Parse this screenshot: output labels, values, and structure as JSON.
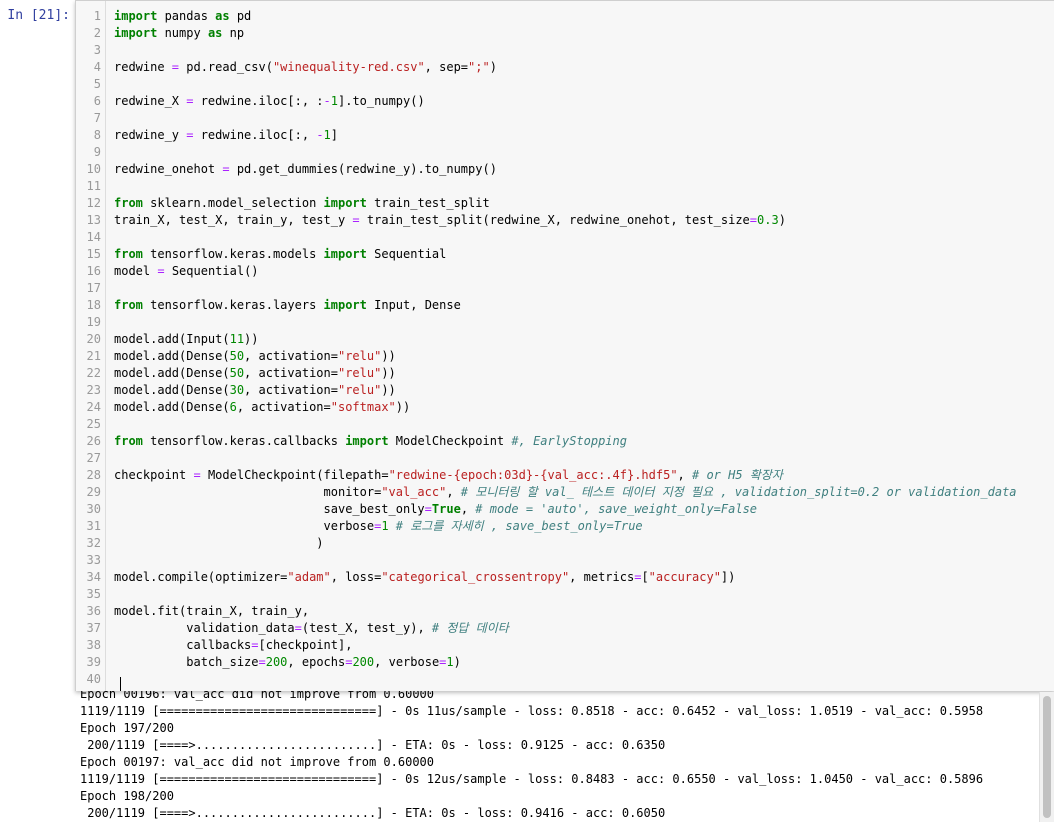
{
  "prompt": "In [21]:",
  "code_lines": [
    {
      "n": "1",
      "segs": [
        [
          "kw",
          "import"
        ],
        [
          "t",
          " pandas "
        ],
        [
          "kw",
          "as"
        ],
        [
          "t",
          " pd"
        ]
      ]
    },
    {
      "n": "2",
      "segs": [
        [
          "kw",
          "import"
        ],
        [
          "t",
          " numpy "
        ],
        [
          "kw",
          "as"
        ],
        [
          "t",
          " np"
        ]
      ]
    },
    {
      "n": "3",
      "segs": []
    },
    {
      "n": "4",
      "segs": [
        [
          "t",
          "redwine "
        ],
        [
          "op",
          "="
        ],
        [
          "t",
          " pd.read_csv("
        ],
        [
          "st",
          "\"winequality-red.csv\""
        ],
        [
          "t",
          ", sep="
        ],
        [
          "st",
          "\";\""
        ],
        [
          "t",
          ")"
        ]
      ]
    },
    {
      "n": "5",
      "segs": []
    },
    {
      "n": "6",
      "segs": [
        [
          "t",
          "redwine_X "
        ],
        [
          "op",
          "="
        ],
        [
          "t",
          " redwine.iloc[:, :"
        ],
        [
          "op",
          "-"
        ],
        [
          "nm",
          "1"
        ],
        [
          "t",
          "].to_numpy()"
        ]
      ]
    },
    {
      "n": "7",
      "segs": []
    },
    {
      "n": "8",
      "segs": [
        [
          "t",
          "redwine_y "
        ],
        [
          "op",
          "="
        ],
        [
          "t",
          " redwine.iloc[:, "
        ],
        [
          "op",
          "-"
        ],
        [
          "nm",
          "1"
        ],
        [
          "t",
          "]"
        ]
      ]
    },
    {
      "n": "9",
      "segs": []
    },
    {
      "n": "10",
      "segs": [
        [
          "t",
          "redwine_onehot "
        ],
        [
          "op",
          "="
        ],
        [
          "t",
          " pd.get_dummies(redwine_y).to_numpy()"
        ]
      ]
    },
    {
      "n": "11",
      "segs": []
    },
    {
      "n": "12",
      "segs": [
        [
          "kw",
          "from"
        ],
        [
          "t",
          " sklearn.model_selection "
        ],
        [
          "kw",
          "import"
        ],
        [
          "t",
          " train_test_split"
        ]
      ]
    },
    {
      "n": "13",
      "segs": [
        [
          "t",
          "train_X, test_X, train_y, test_y "
        ],
        [
          "op",
          "="
        ],
        [
          "t",
          " train_test_split(redwine_X, redwine_onehot, test_size"
        ],
        [
          "op",
          "="
        ],
        [
          "nm",
          "0.3"
        ],
        [
          "t",
          ")"
        ]
      ]
    },
    {
      "n": "14",
      "segs": []
    },
    {
      "n": "15",
      "segs": [
        [
          "kw",
          "from"
        ],
        [
          "t",
          " tensorflow.keras.models "
        ],
        [
          "kw",
          "import"
        ],
        [
          "t",
          " Sequential"
        ]
      ]
    },
    {
      "n": "16",
      "segs": [
        [
          "t",
          "model "
        ],
        [
          "op",
          "="
        ],
        [
          "t",
          " Sequential()"
        ]
      ]
    },
    {
      "n": "17",
      "segs": []
    },
    {
      "n": "18",
      "segs": [
        [
          "kw",
          "from"
        ],
        [
          "t",
          " tensorflow.keras.layers "
        ],
        [
          "kw",
          "import"
        ],
        [
          "t",
          " Input, Dense"
        ]
      ]
    },
    {
      "n": "19",
      "segs": []
    },
    {
      "n": "20",
      "segs": [
        [
          "t",
          "model.add(Input("
        ],
        [
          "nm",
          "11"
        ],
        [
          "t",
          "))"
        ]
      ]
    },
    {
      "n": "21",
      "segs": [
        [
          "t",
          "model.add(Dense("
        ],
        [
          "nm",
          "50"
        ],
        [
          "t",
          ", activation="
        ],
        [
          "st",
          "\"relu\""
        ],
        [
          "t",
          "))"
        ]
      ]
    },
    {
      "n": "22",
      "segs": [
        [
          "t",
          "model.add(Dense("
        ],
        [
          "nm",
          "50"
        ],
        [
          "t",
          ", activation="
        ],
        [
          "st",
          "\"relu\""
        ],
        [
          "t",
          "))"
        ]
      ]
    },
    {
      "n": "23",
      "segs": [
        [
          "t",
          "model.add(Dense("
        ],
        [
          "nm",
          "30"
        ],
        [
          "t",
          ", activation="
        ],
        [
          "st",
          "\"relu\""
        ],
        [
          "t",
          "))"
        ]
      ]
    },
    {
      "n": "24",
      "segs": [
        [
          "t",
          "model.add(Dense("
        ],
        [
          "nm",
          "6"
        ],
        [
          "t",
          ", activation="
        ],
        [
          "st",
          "\"softmax\""
        ],
        [
          "t",
          "))"
        ]
      ]
    },
    {
      "n": "25",
      "segs": []
    },
    {
      "n": "26",
      "segs": [
        [
          "kw",
          "from"
        ],
        [
          "t",
          " tensorflow.keras.callbacks "
        ],
        [
          "kw",
          "import"
        ],
        [
          "t",
          " ModelCheckpoint "
        ],
        [
          "cm",
          "#, EarlyStopping"
        ]
      ]
    },
    {
      "n": "27",
      "segs": []
    },
    {
      "n": "28",
      "segs": [
        [
          "t",
          "checkpoint "
        ],
        [
          "op",
          "="
        ],
        [
          "t",
          " ModelCheckpoint(filepath="
        ],
        [
          "st",
          "\"redwine-{epoch:03d}-{val_acc:.4f}.hdf5\""
        ],
        [
          "t",
          ", "
        ],
        [
          "cm",
          "# or H5 확장자"
        ]
      ]
    },
    {
      "n": "29",
      "segs": [
        [
          "t",
          "                             monitor="
        ],
        [
          "st",
          "\"val_acc\""
        ],
        [
          "t",
          ", "
        ],
        [
          "cm",
          "# 모니터링 할 val_ 테스트 데이터 지정 필요 , validation_split=0.2 or validation_data"
        ]
      ]
    },
    {
      "n": "30",
      "segs": [
        [
          "t",
          "                             save_best_only"
        ],
        [
          "op",
          "="
        ],
        [
          "kw",
          "True"
        ],
        [
          "t",
          ", "
        ],
        [
          "cm",
          "# mode = 'auto', save_weight_only=False"
        ]
      ]
    },
    {
      "n": "31",
      "segs": [
        [
          "t",
          "                             verbose"
        ],
        [
          "op",
          "="
        ],
        [
          "nm",
          "1"
        ],
        [
          "t",
          " "
        ],
        [
          "cm",
          "# 로그를 자세히 , save_best_only=True"
        ]
      ]
    },
    {
      "n": "32",
      "segs": [
        [
          "t",
          "                            )"
        ]
      ]
    },
    {
      "n": "33",
      "segs": []
    },
    {
      "n": "34",
      "segs": [
        [
          "t",
          "model.compile(optimizer="
        ],
        [
          "st",
          "\"adam\""
        ],
        [
          "t",
          ", loss="
        ],
        [
          "st",
          "\"categorical_crossentropy\""
        ],
        [
          "t",
          ", metrics"
        ],
        [
          "op",
          "="
        ],
        [
          "t",
          "["
        ],
        [
          "st",
          "\"accuracy\""
        ],
        [
          "t",
          "])"
        ]
      ]
    },
    {
      "n": "35",
      "segs": []
    },
    {
      "n": "36",
      "segs": [
        [
          "t",
          "model.fit(train_X, train_y,"
        ]
      ]
    },
    {
      "n": "37",
      "segs": [
        [
          "t",
          "          validation_data"
        ],
        [
          "op",
          "="
        ],
        [
          "t",
          "(test_X, test_y), "
        ],
        [
          "cm",
          "# 정답 데이타"
        ]
      ]
    },
    {
      "n": "38",
      "segs": [
        [
          "t",
          "          callbacks"
        ],
        [
          "op",
          "="
        ],
        [
          "t",
          "[checkpoint],"
        ]
      ]
    },
    {
      "n": "39",
      "segs": [
        [
          "t",
          "          batch_size"
        ],
        [
          "op",
          "="
        ],
        [
          "nm",
          "200"
        ],
        [
          "t",
          ", epochs"
        ],
        [
          "op",
          "="
        ],
        [
          "nm",
          "200"
        ],
        [
          "t",
          ", verbose"
        ],
        [
          "op",
          "="
        ],
        [
          "nm",
          "1"
        ],
        [
          "t",
          ")"
        ]
      ]
    },
    {
      "n": "40",
      "segs": []
    }
  ],
  "output_lines": [
    "Epoch 00196: val_acc did not improve from 0.60000",
    "1119/1119 [==============================] - 0s 11us/sample - loss: 0.8518 - acc: 0.6452 - val_loss: 1.0519 - val_acc: 0.5958",
    "Epoch 197/200",
    " 200/1119 [====>.........................] - ETA: 0s - loss: 0.9125 - acc: 0.6350",
    "Epoch 00197: val_acc did not improve from 0.60000",
    "1119/1119 [==============================] - 0s 12us/sample - loss: 0.8483 - acc: 0.6550 - val_loss: 1.0450 - val_acc: 0.5896",
    "Epoch 198/200",
    " 200/1119 [====>.........................] - ETA: 0s - loss: 0.9416 - acc: 0.6050"
  ]
}
